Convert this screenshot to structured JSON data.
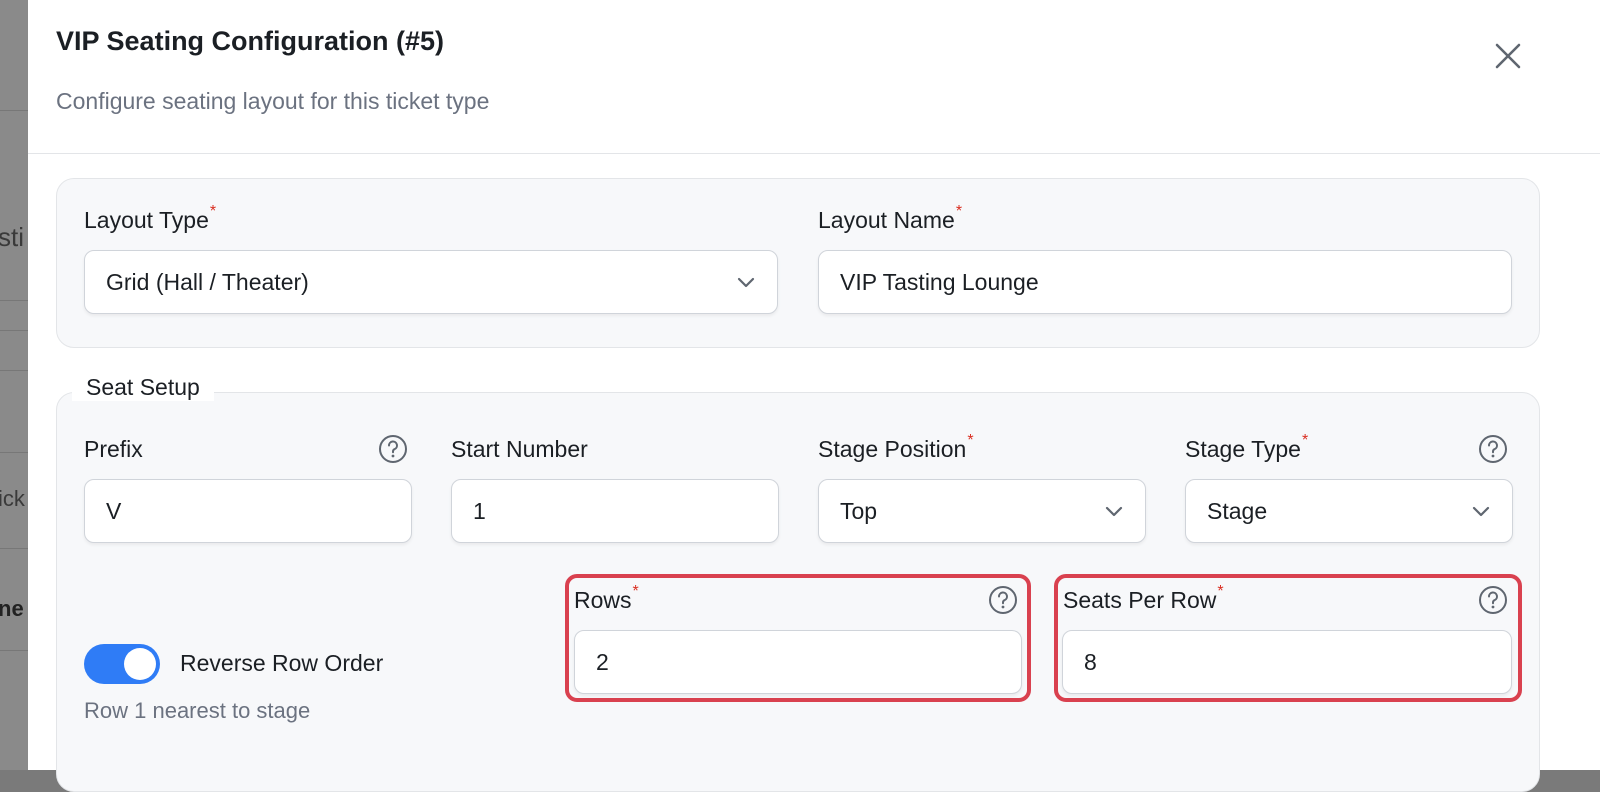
{
  "background": {
    "fragments": [
      "sti",
      "ick",
      "ne"
    ]
  },
  "modal": {
    "title": "VIP Seating Configuration (#5)",
    "subtitle": "Configure seating layout for this ticket type",
    "close_icon": "close-icon"
  },
  "layout": {
    "type_label": "Layout Type",
    "type_value": "Grid (Hall / Theater)",
    "name_label": "Layout Name",
    "name_value": "VIP Tasting Lounge"
  },
  "seat_setup": {
    "legend": "Seat Setup",
    "prefix_label": "Prefix",
    "prefix_value": "V",
    "start_label": "Start Number",
    "start_value": "1",
    "stage_position_label": "Stage Position",
    "stage_position_value": "Top",
    "stage_type_label": "Stage Type",
    "stage_type_value": "Stage",
    "rows_label": "Rows",
    "rows_value": "2",
    "seats_label": "Seats Per Row",
    "seats_value": "8",
    "reverse_label": "Reverse Row Order",
    "reverse_on": true,
    "reverse_hint": "Row 1 nearest to stage"
  },
  "required_marker": "*",
  "colors": {
    "accent": "#2f7cf6",
    "required": "#d92d20",
    "highlight": "#d9414f"
  }
}
